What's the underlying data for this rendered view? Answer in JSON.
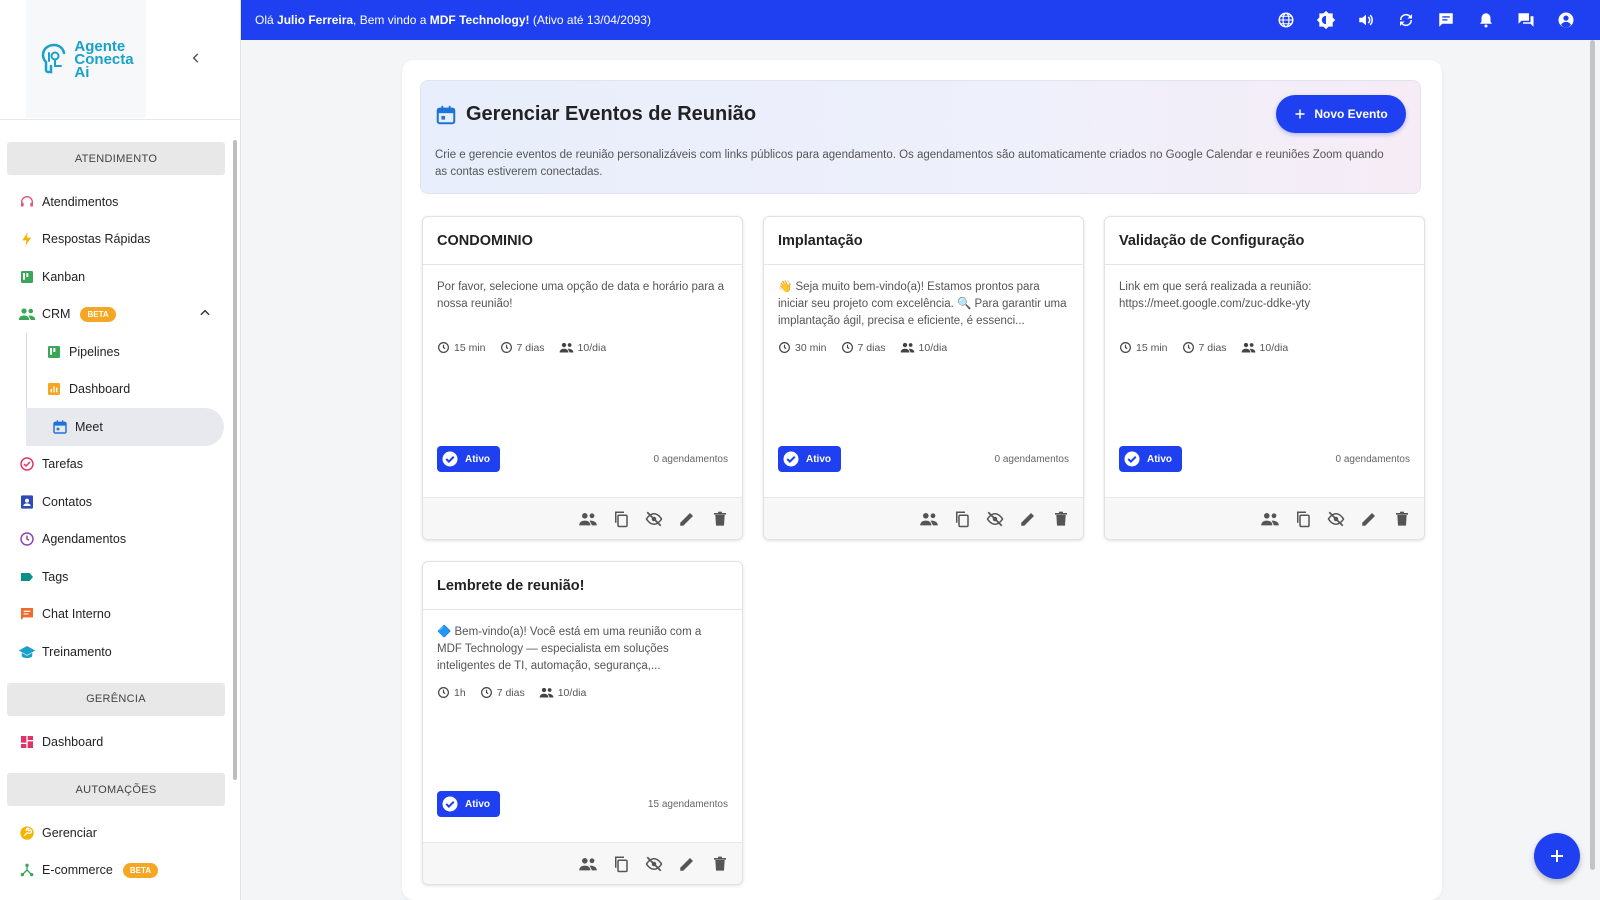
{
  "brand": {
    "logo_lines": [
      "Agente",
      "Conecta",
      "Ai"
    ]
  },
  "sidebar": {
    "sections": {
      "atendimento": "ATENDIMENTO",
      "gerencia": "GERÊNCIA",
      "automacoes": "AUTOMAÇÕES"
    },
    "items": {
      "atendimentos": "Atendimentos",
      "respostas": "Respostas Rápidas",
      "kanban": "Kanban",
      "crm": "CRM",
      "crm_badge": "BETA",
      "pipelines": "Pipelines",
      "dashboard_crm": "Dashboard",
      "meet": "Meet",
      "tarefas": "Tarefas",
      "contatos": "Contatos",
      "agendamentos": "Agendamentos",
      "tags": "Tags",
      "chat_interno": "Chat Interno",
      "treinamento": "Treinamento",
      "dashboard": "Dashboard",
      "gerenciar": "Gerenciar",
      "ecommerce": "E-commerce",
      "ecommerce_badge": "BETA"
    }
  },
  "topbar": {
    "greeting_prefix": "Olá ",
    "user": "Julio Ferreira",
    "welcome": ", Bem vindo a ",
    "company": "MDF Technology!",
    "active_until": " (Ativo até 13/04/2093)"
  },
  "header": {
    "title": "Gerenciar Eventos de Reunião",
    "description": "Crie e gerencie eventos de reunião personalizáveis com links públicos para agendamento. Os agendamentos são automaticamente criados no Google Calendar e reuniões Zoom quando as contas estiverem conectadas.",
    "new_button": "Novo Evento"
  },
  "events": [
    {
      "title": "CONDOMINIO",
      "description": "Por favor, selecione uma opção de data e horário para a nossa reunião!",
      "duration": "15 min",
      "window": "7 dias",
      "limit": "10/dia",
      "status": "Ativo",
      "bookings": "0 agendamentos"
    },
    {
      "title": "Implantação",
      "description": "👋 Seja muito bem-vindo(a)! Estamos prontos para iniciar seu projeto com excelência. 🔍 Para garantir uma implantação ágil, precisa e eficiente, é essenci...",
      "duration": "30 min",
      "window": "7 dias",
      "limit": "10/dia",
      "status": "Ativo",
      "bookings": "0 agendamentos"
    },
    {
      "title": "Validação de Configuração",
      "description": "Link em que será realizada a reunião: https://meet.google.com/zuc-ddke-yty",
      "duration": "15 min",
      "window": "7 dias",
      "limit": "10/dia",
      "status": "Ativo",
      "bookings": "0 agendamentos"
    },
    {
      "title": "Lembrete de reunião!",
      "description": "🔷 Bem-vindo(a)! Você está em uma reunião com a MDF Technology — especialista em soluções inteligentes de TI, automação, segurança,...",
      "duration": "1h",
      "window": "7 dias",
      "limit": "10/dia",
      "status": "Ativo",
      "bookings": "15 agendamentos"
    }
  ],
  "colors": {
    "primary": "#1e40f0",
    "beta": "#f5a623"
  }
}
